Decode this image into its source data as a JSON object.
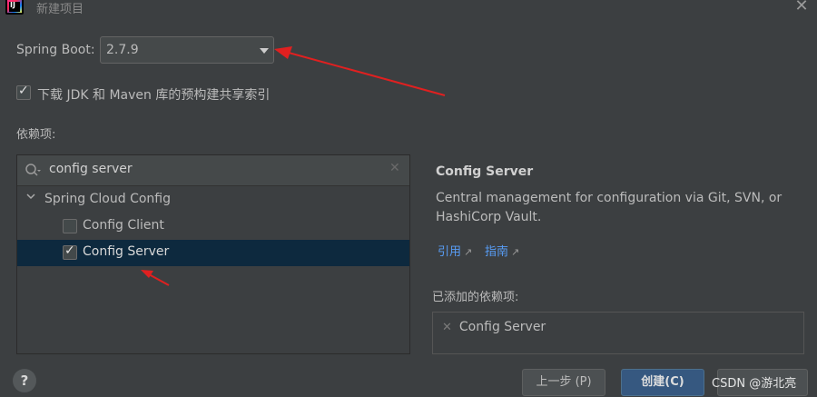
{
  "window": {
    "title": "新建项目"
  },
  "spring_boot": {
    "label": "Spring Boot:",
    "version": "2.7.9"
  },
  "download_index": {
    "checked": true,
    "label": "下载 JDK 和 Maven 库的预构建共享索引"
  },
  "dependencies": {
    "label": "依赖项:",
    "search": {
      "value": "config server"
    },
    "tree": {
      "group": "Spring Cloud Config",
      "items": [
        {
          "label": "Config Client",
          "checked": false,
          "selected": false
        },
        {
          "label": "Config Server",
          "checked": true,
          "selected": true
        }
      ]
    }
  },
  "details": {
    "title": "Config Server",
    "description": "Central management for configuration via Git, SVN, or HashiCorp Vault.",
    "links": [
      {
        "label": "引用"
      },
      {
        "label": "指南"
      }
    ]
  },
  "added": {
    "label": "已添加的依赖项:",
    "items": [
      "Config Server"
    ]
  },
  "footer": {
    "help": "?",
    "prev": "上一步 (P)",
    "create": "创建(C)",
    "watermark": "CSDN @游北亮"
  },
  "colors": {
    "background": "#3c3f41",
    "selection": "#0d293e",
    "primary_button": "#365880",
    "link": "#589df6",
    "annotation_arrow": "#e02020"
  }
}
